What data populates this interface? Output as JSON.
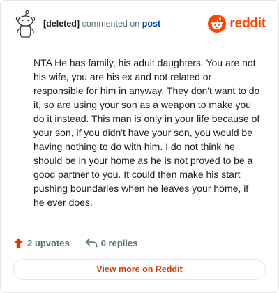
{
  "comment": {
    "author": "[deleted]",
    "action_text": "commented on",
    "target_link": "post",
    "body": "NTA He has family, his adult daughters. You are not his wife, you are his ex and not related or responsible for him in anyway. They don't want to do it, so are using your son as a weapon to make you do it instead. This man is only in your life because of your son, if you didn't have your son, you would be having nothing to do with him. I do not think he should be in your home as he is not proved to be a good partner to you. It could then make his start pushing boundaries when he leaves your home, if he ever does."
  },
  "brand": {
    "wordmark": "reddit",
    "icon": "reddit-snoo-icon",
    "color": "#ff4500"
  },
  "avatar": {
    "icon": "deleted-user-snoo-icon"
  },
  "actions": {
    "upvotes": "2 upvotes",
    "upvote_icon": "upvote-arrow-icon",
    "upvote_color": "#d93a00",
    "replies": "0 replies",
    "reply_icon": "reply-arrow-icon"
  },
  "view_more": {
    "label": "View more on Reddit"
  }
}
